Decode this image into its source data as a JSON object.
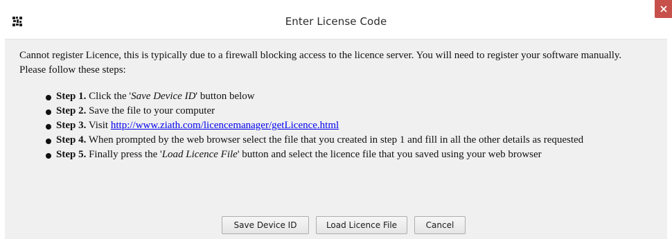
{
  "window": {
    "title": "Enter License Code",
    "close_symbol": "×"
  },
  "message": {
    "intro": "Cannot register Licence, this is typically due to a firewall blocking access to the licence server. You will need to register your software manually. Please follow these steps:"
  },
  "steps": [
    {
      "label": "Step 1.",
      "pre": " Click the '",
      "em": "Save Device ID",
      "post": "' button below"
    },
    {
      "label": "Step 2.",
      "pre": " Save the file to your computer"
    },
    {
      "label": "Step 3.",
      "pre": " Visit ",
      "link": "http://www.ziath.com/licencemanager/getLicence.html"
    },
    {
      "label": "Step 4.",
      "pre": " When prompted by the web browser select the file that you created in step 1 and fill in all the other details as requested"
    },
    {
      "label": "Step 5.",
      "pre": " Finally press the '",
      "em": "Load Licence File",
      "post": "' button and select the licence file that you saved using your web browser"
    }
  ],
  "buttons": {
    "save_device_id": "Save Device ID",
    "load_licence_file": "Load Licence File",
    "cancel": "Cancel"
  },
  "icons": {
    "app": "app-logo-icon",
    "close": "close-icon",
    "bullet": "bullet-icon"
  },
  "colors": {
    "close_bg": "#c7504b",
    "link": "#0000ee",
    "content_bg": "#f0f0f0"
  }
}
